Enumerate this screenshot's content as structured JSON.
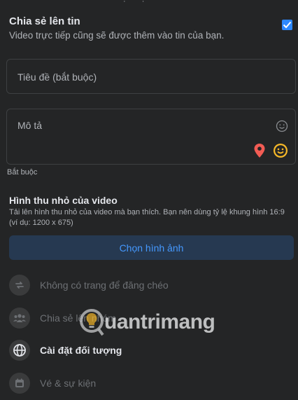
{
  "share": {
    "title": "Chia sẻ lên tin",
    "subtitle": "Video trực tiếp cũng sẽ được thêm vào tin của bạn.",
    "checked": true
  },
  "form": {
    "title_placeholder": "Tiêu đề (bắt buộc)",
    "description_placeholder": "Mô tả",
    "required_note": "Bắt buộc"
  },
  "thumbnail": {
    "title": "Hình thu nhỏ của video",
    "description": "Tải lên hình thu nhỏ của video mà bạn thích. Bạn nên dùng tỷ lệ khung hình 16:9 (ví dụ: 1200 x 675)",
    "button_label": "Chọn hình ảnh"
  },
  "options": [
    {
      "label": "Không có trang để đăng chéo",
      "icon": "crosspost-icon",
      "enabled": false
    },
    {
      "label": "Chia sẻ lên nhóm",
      "icon": "group-icon",
      "enabled": false
    },
    {
      "label": "Cài đặt đối tượng",
      "icon": "globe-icon",
      "enabled": true
    },
    {
      "label": "Vé & sự kiện",
      "icon": "ticket-icon",
      "enabled": false
    }
  ],
  "watermark": {
    "text": "uantrimang"
  },
  "colors": {
    "background": "#242526",
    "accent": "#2d88ff",
    "button_bg": "#263951",
    "button_text": "#4599ff",
    "pin": "#f25c54",
    "emoji": "#f7b928"
  }
}
